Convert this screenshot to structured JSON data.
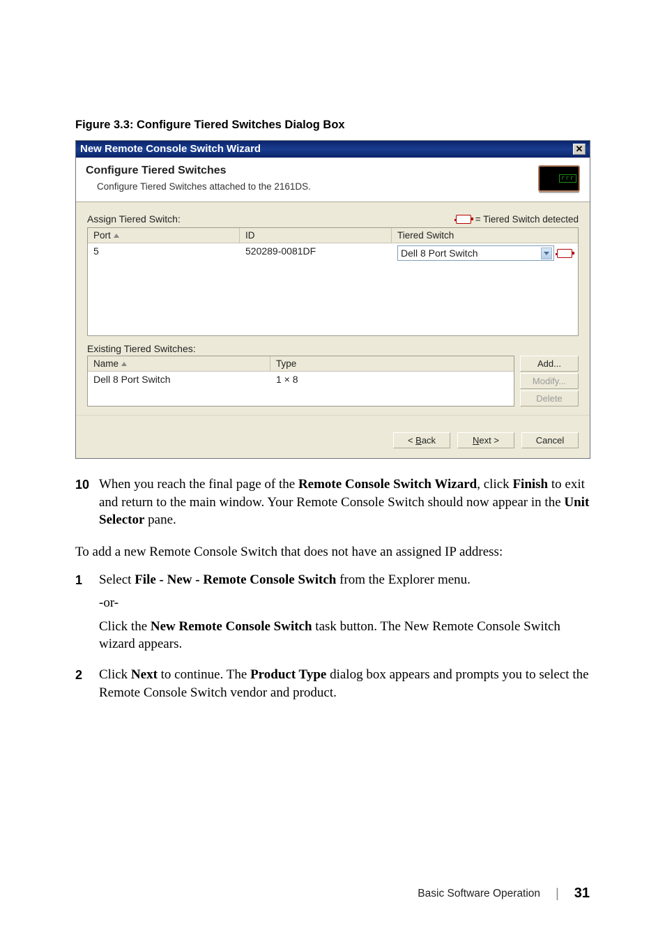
{
  "figure_caption": "Figure 3.3: Configure Tiered Switches Dialog Box",
  "dialog": {
    "title": "New Remote Console Switch Wizard",
    "close_glyph": "✕",
    "header": {
      "title": "Configure Tiered Switches",
      "subtitle": "Configure Tiered Switches attached to the 2161DS."
    },
    "assign_label": "Assign Tiered Switch:",
    "legend": " = Tiered Switch detected",
    "assign_columns": {
      "port": "Port",
      "id": "ID",
      "tiered": "Tiered Switch"
    },
    "assign_row": {
      "port": "5",
      "id": "520289-0081DF",
      "tiered": "Dell 8 Port Switch"
    },
    "existing_label": "Existing Tiered Switches:",
    "existing_columns": {
      "name": "Name",
      "type": "Type"
    },
    "existing_row": {
      "name": "Dell 8 Port Switch",
      "type": "1 × 8"
    },
    "buttons": {
      "add": "Add...",
      "modify": "Modify...",
      "delete": "Delete",
      "back_prefix": "< ",
      "back_u": "B",
      "back_rest": "ack",
      "next_u": "N",
      "next_rest": "ext >",
      "cancel": "Cancel"
    }
  },
  "doc": {
    "step10_num": "10",
    "step10_a": "When you reach the final page of the ",
    "step10_b": "Remote Console Switch Wizard",
    "step10_c": ", click ",
    "step10_d": "Finish",
    "step10_e": " to exit and return to the main window. Your Remote Console Switch should now appear in the ",
    "step10_f": "Unit Selector",
    "step10_g": " pane.",
    "para_a": "To add a new Remote Console Switch that does not have an assigned IP address:",
    "step1_num": "1",
    "step1_a": "Select ",
    "step1_b": "File - New - Remote Console Switch",
    "step1_c": " from the Explorer menu.",
    "step1_or": "-or-",
    "step1_d": "Click the ",
    "step1_e": "New Remote Console Switch",
    "step1_f": " task button. The New Remote Console wizard appears.",
    "step1_f_full": " task button. The New Remote Console Switch wizard appears.",
    "step2_num": "2",
    "step2_a": "Click ",
    "step2_b": "Next",
    "step2_c": " to continue. The ",
    "step2_d": "Product Type",
    "step2_e": " dialog box appears and prompts you to select the Remote Console Switch vendor and product."
  },
  "footer": {
    "section": "Basic Software Operation",
    "page": "31"
  }
}
